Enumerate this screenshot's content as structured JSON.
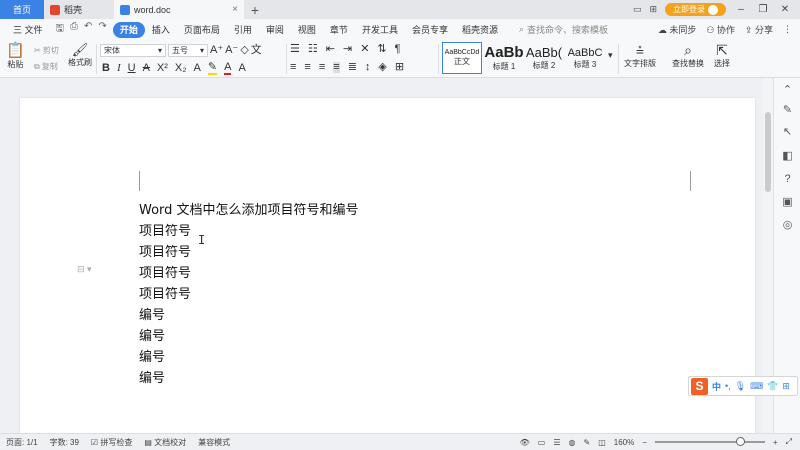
{
  "titlebar": {
    "tabs": [
      {
        "label": "首页",
        "icon": "home"
      },
      {
        "label": "稻壳",
        "icon": "docer-icon"
      },
      {
        "label": "word.doc",
        "icon": "word-doc-icon"
      }
    ],
    "login_label": "立即登录"
  },
  "menubar": {
    "file_label": "三 文件",
    "items": [
      "开始",
      "插入",
      "页面布局",
      "引用",
      "审阅",
      "视图",
      "章节",
      "开发工具",
      "会员专享",
      "稻壳资源"
    ],
    "active": "开始",
    "search_placeholder": "查找命令、搜索模板",
    "right": [
      "未同步",
      "协作",
      "分享"
    ]
  },
  "ribbon": {
    "paste": "粘贴",
    "cut": "剪切",
    "copy": "复制",
    "format_painter": "格式刷",
    "font_name": "宋体",
    "font_size": "五号",
    "styles": [
      {
        "sample": "AaBbCcDd",
        "label": "正文"
      },
      {
        "sample": "AaBb",
        "label": "标题 1"
      },
      {
        "sample": "AaBb(",
        "label": "标题 2"
      },
      {
        "sample": "AaBbC",
        "label": "标题 3"
      }
    ],
    "text_layout": "文字排版",
    "find_replace": "查找替换",
    "select": "选择"
  },
  "document": {
    "lines": [
      "Word 文档中怎么添加项目符号和编号",
      "项目符号",
      "项目符号",
      "项目符号",
      "项目符号",
      "编号",
      "编号",
      "编号",
      "编号"
    ]
  },
  "ime": {
    "logo": "S",
    "mode": "中"
  },
  "statusbar": {
    "page": "页面: 1/1",
    "words": "字数: 39",
    "spell": "拼写检查",
    "proof": "文档校对",
    "compat": "兼容模式",
    "zoom": "160%",
    "zoom_level": 0.77
  },
  "colors": {
    "accent": "#3a82e6",
    "login": "#f4a21b",
    "ime": "#f0602a"
  }
}
